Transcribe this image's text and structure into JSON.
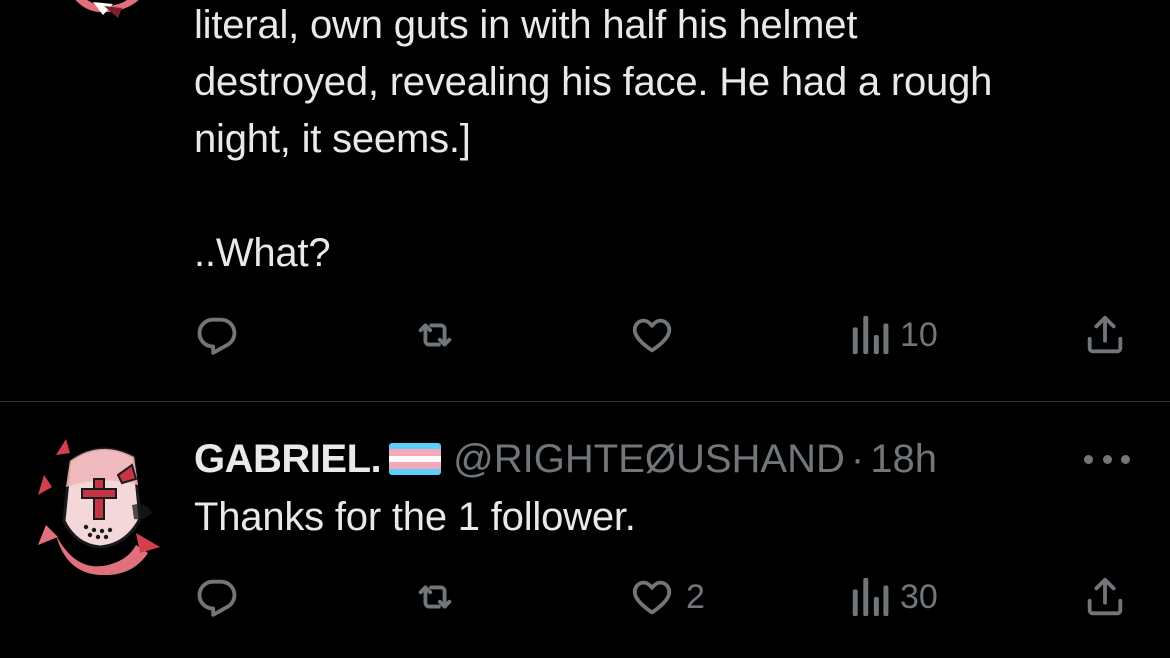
{
  "colors": {
    "background": "#000000",
    "text_primary": "#e7e9ea",
    "text_secondary": "#71767b",
    "divider": "#2f3336",
    "avatar_accent": "#e0707c"
  },
  "tweet1": {
    "text_lines": [
      "literal, own guts in with half his helmet",
      "destroyed, revealing his face. He had a rough",
      "night, it seems.]",
      "..What?"
    ],
    "actions": {
      "reply": {
        "icon": "reply-icon",
        "count": ""
      },
      "retweet": {
        "icon": "retweet-icon",
        "count": ""
      },
      "like": {
        "icon": "heart-icon",
        "count": ""
      },
      "views": {
        "icon": "views-icon",
        "count": "10"
      },
      "share": {
        "icon": "share-icon"
      }
    }
  },
  "tweet2": {
    "display_name": "GABRIEL.",
    "flag": "transgender-flag-emoji",
    "handle": "@RIGHTEØUSHAND",
    "separator": "·",
    "time": "18h",
    "text": "Thanks for the 1 follower.",
    "actions": {
      "reply": {
        "icon": "reply-icon",
        "count": ""
      },
      "retweet": {
        "icon": "retweet-icon",
        "count": ""
      },
      "like": {
        "icon": "heart-icon",
        "count": "2"
      },
      "views": {
        "icon": "views-icon",
        "count": "30"
      },
      "share": {
        "icon": "share-icon"
      }
    }
  }
}
